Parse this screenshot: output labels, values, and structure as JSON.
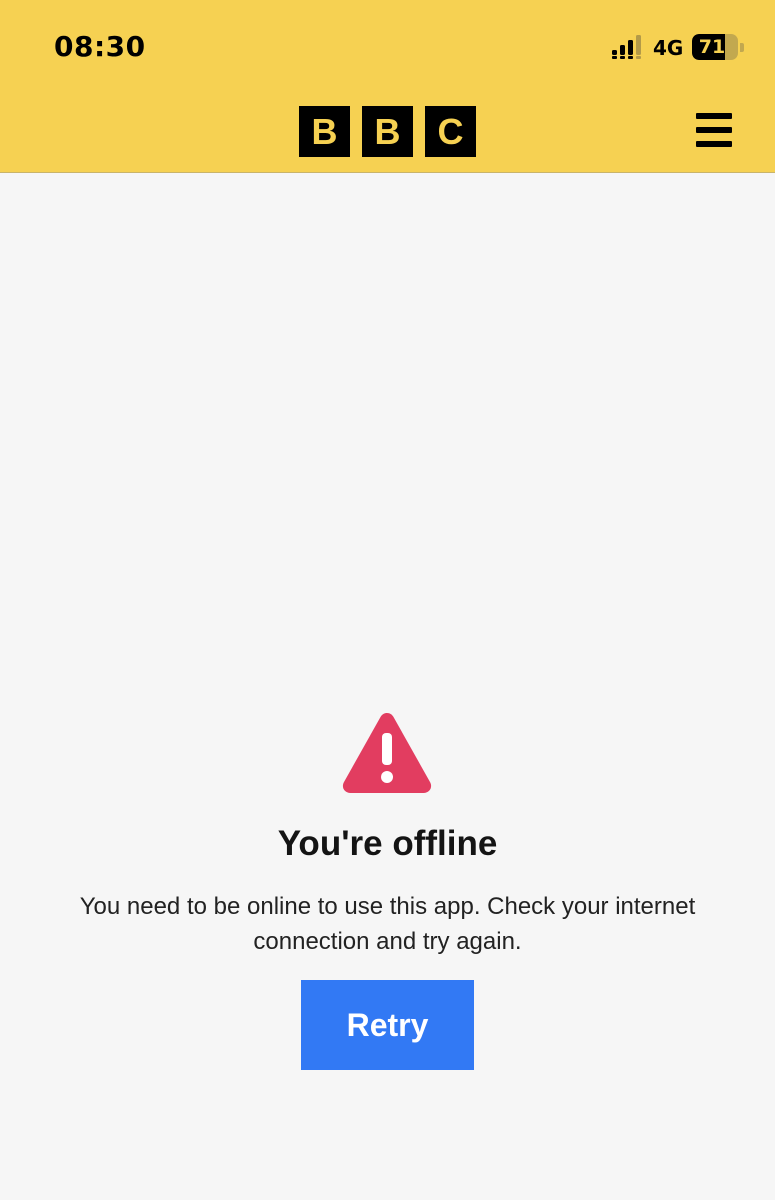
{
  "status_bar": {
    "time": "08:30",
    "network": "4G",
    "battery_percent": 71,
    "battery_label": "71",
    "signal_icon": "cellular-signal-icon",
    "battery_icon": "battery-icon"
  },
  "header": {
    "logo_letters": [
      "B",
      "B",
      "C"
    ],
    "menu_icon": "hamburger-menu-icon",
    "background_color": "#f6d152"
  },
  "offline": {
    "icon": "warning-triangle-icon",
    "icon_color": "#e23d60",
    "title": "You're offline",
    "message": "You need to be online to use this app. Check your internet connection and try again.",
    "retry_label": "Retry",
    "retry_color": "#3279f4"
  }
}
